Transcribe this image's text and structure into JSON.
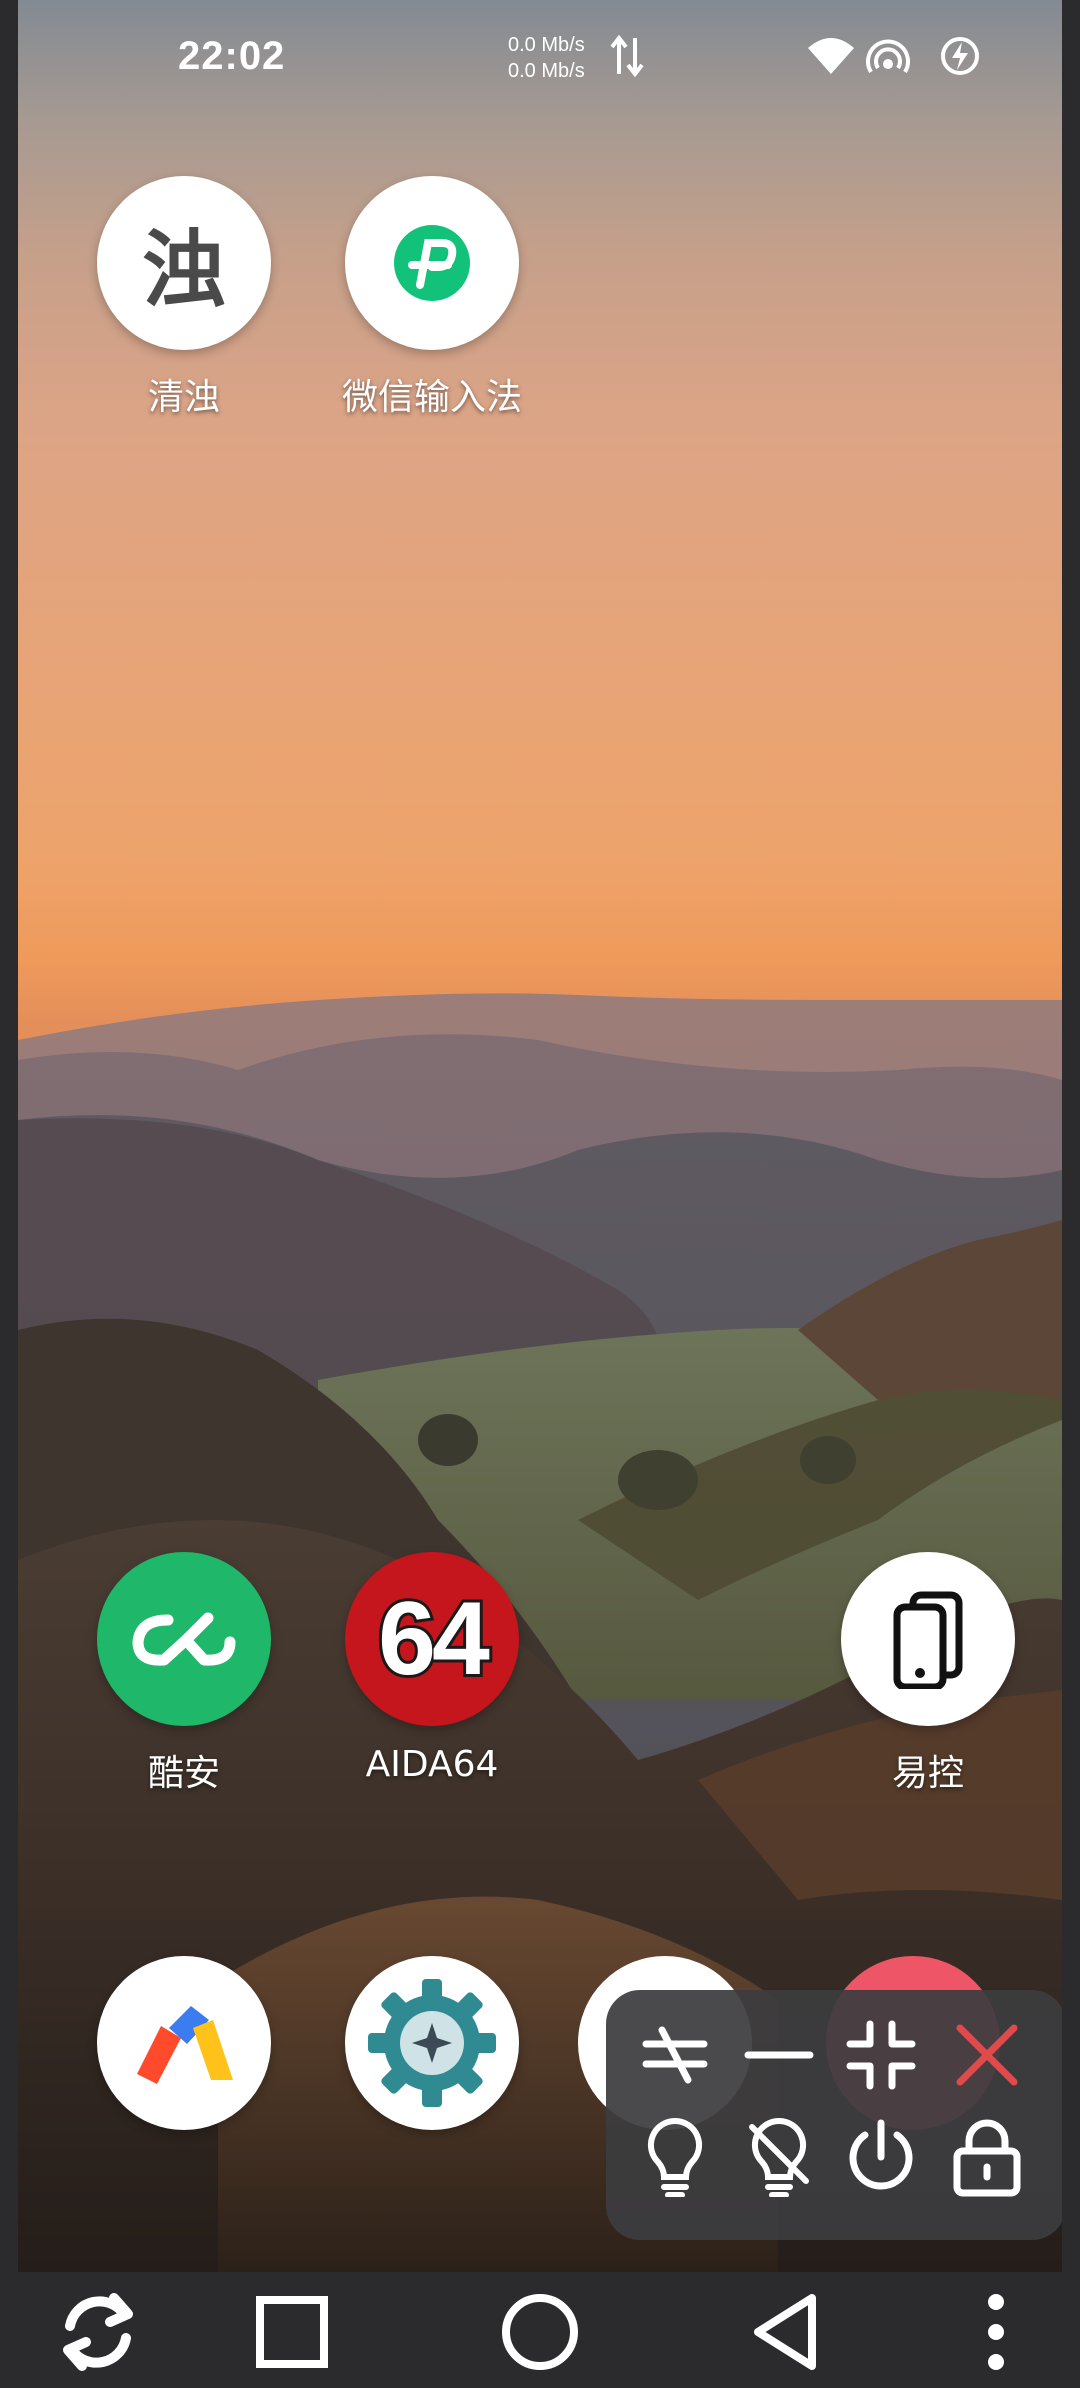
{
  "status_bar": {
    "time": "22:02",
    "upload_speed": "0.0 Mb/s",
    "download_speed": "0.0 Mb/s"
  },
  "apps_top": [
    {
      "label": "清浊",
      "icon": "qingzhuo-icon",
      "glyph": "浊"
    },
    {
      "label": "微信输入法",
      "icon": "wechat-input-icon"
    }
  ],
  "apps_middle": [
    {
      "label": "酷安",
      "icon": "coolapk-icon"
    },
    {
      "label": "AIDA64",
      "icon": "aida64-icon",
      "glyph": "64"
    },
    {
      "label": "易控",
      "icon": "easycontrol-icon"
    }
  ],
  "apps_bottom": [
    {
      "label": "",
      "icon": "via-browser-icon"
    },
    {
      "label": "",
      "icon": "gear-app-icon"
    }
  ],
  "floating_panel": {
    "buttons": [
      "switch-icon",
      "minimize-icon",
      "fullscreen-exit-icon",
      "close-icon",
      "light-on-icon",
      "light-off-icon",
      "power-icon",
      "lock-icon"
    ]
  },
  "navigation": {
    "buttons": [
      "rotate-icon",
      "recents-icon",
      "home-icon",
      "back-icon",
      "more-icon"
    ]
  },
  "colors": {
    "coolapk_green": "#1fb86a",
    "wechat_green": "#12c27a",
    "aida_red": "#c4161c",
    "close_red": "#e14a4a"
  }
}
